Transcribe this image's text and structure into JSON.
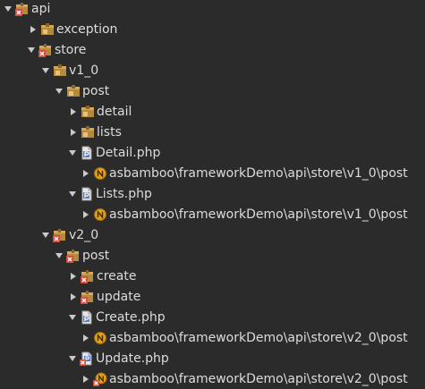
{
  "tree": {
    "items": [
      {
        "label": "api",
        "expanded": true,
        "icon": "package-error-icon"
      },
      {
        "label": "exception",
        "expanded": false,
        "icon": "package-icon"
      },
      {
        "label": "store",
        "expanded": true,
        "icon": "package-error-icon"
      },
      {
        "label": "v1_0",
        "expanded": true,
        "icon": "package-icon"
      },
      {
        "label": "post",
        "expanded": true,
        "icon": "package-icon"
      },
      {
        "label": "detail",
        "expanded": false,
        "icon": "package-icon"
      },
      {
        "label": "lists",
        "expanded": false,
        "icon": "package-icon"
      },
      {
        "label": "Detail.php",
        "expanded": true,
        "icon": "php-file-icon"
      },
      {
        "label": "asbamboo\\frameworkDemo\\api\\store\\v1_0\\post",
        "expanded": false,
        "icon": "namespace-icon"
      },
      {
        "label": "Lists.php",
        "expanded": true,
        "icon": "php-file-icon"
      },
      {
        "label": "asbamboo\\frameworkDemo\\api\\store\\v1_0\\post",
        "expanded": false,
        "icon": "namespace-icon"
      },
      {
        "label": "v2_0",
        "expanded": true,
        "icon": "package-error-icon"
      },
      {
        "label": "post",
        "expanded": true,
        "icon": "package-error-icon"
      },
      {
        "label": "create",
        "expanded": false,
        "icon": "package-error-icon"
      },
      {
        "label": "update",
        "expanded": false,
        "icon": "package-error-icon"
      },
      {
        "label": "Create.php",
        "expanded": true,
        "icon": "php-file-icon"
      },
      {
        "label": "asbamboo\\frameworkDemo\\api\\store\\v2_0\\post",
        "expanded": false,
        "icon": "namespace-icon"
      },
      {
        "label": "Update.php",
        "expanded": true,
        "icon": "php-file-error-icon"
      },
      {
        "label": "asbamboo\\frameworkDemo\\api\\store\\v2_0\\post",
        "expanded": false,
        "icon": "namespace-error-icon"
      }
    ]
  },
  "colors": {
    "background": "#2b2b2b",
    "text": "#dcdcdc",
    "arrow": "#c9c9c9",
    "package_brown": "#b58a3c",
    "error_red": "#d84a3a",
    "php_blue": "#4d7bd1",
    "namespace_orange": "#e2a01a"
  }
}
